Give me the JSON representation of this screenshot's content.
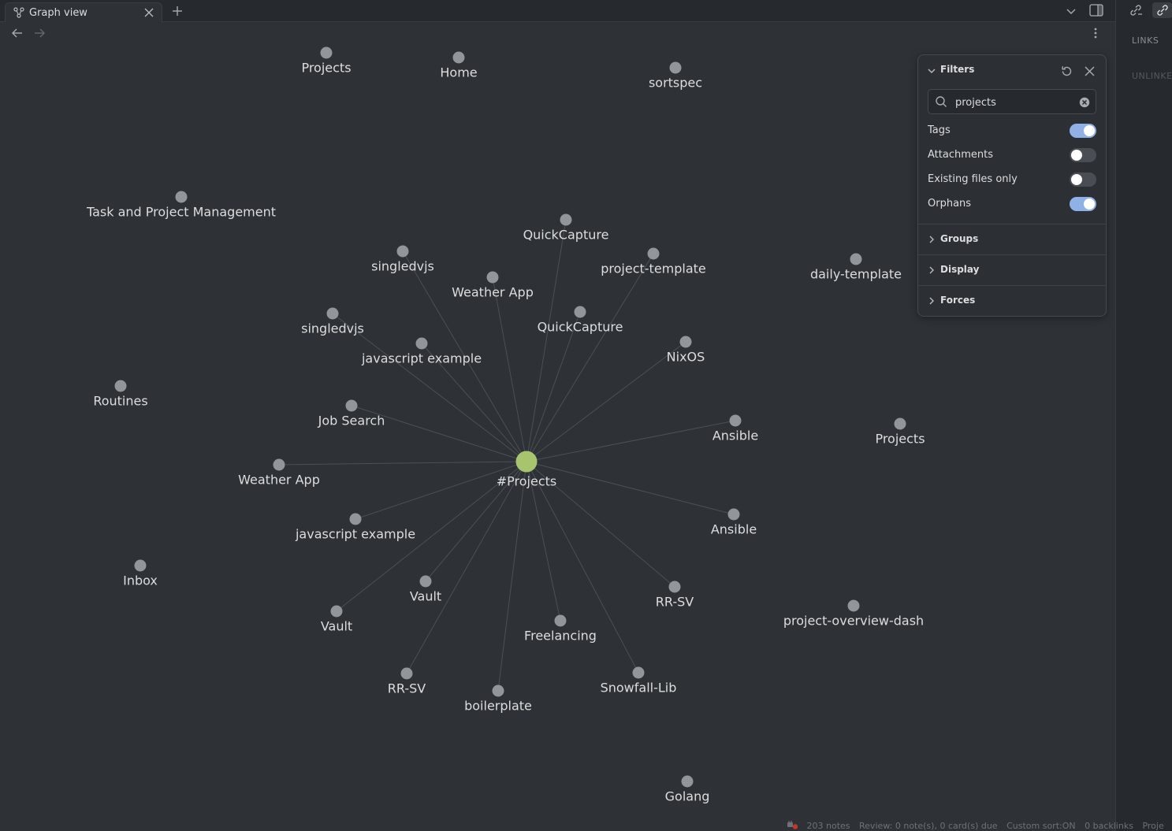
{
  "tab": {
    "title": "Graph view",
    "icon": "graph-icon"
  },
  "toolbar": {
    "back": "arrow-left-icon",
    "forward": "arrow-right-icon",
    "more": "more-vertical-icon"
  },
  "right_panel": {
    "links_label": "LINKS",
    "unlinked_label": "UNLINKE"
  },
  "filters": {
    "title": "Filters",
    "search": {
      "value": "projects"
    },
    "toggles": [
      {
        "label": "Tags",
        "on": true
      },
      {
        "label": "Attachments",
        "on": false
      },
      {
        "label": "Existing files only",
        "on": false
      },
      {
        "label": "Orphans",
        "on": true
      }
    ],
    "sections": [
      "Groups",
      "Display",
      "Forces"
    ]
  },
  "graph": {
    "center": "#Projects",
    "connected": [
      "QuickCapture",
      "project-template",
      "singledvjs",
      "Weather App",
      "singledvjs",
      "QuickCapture",
      "javascript example",
      "NixOS",
      "Job Search",
      "Ansible",
      "Weather App",
      "Ansible",
      "javascript example",
      "Vault",
      "RR-SV",
      "Vault",
      "Freelancing",
      "RR-SV",
      "Snowfall-Lib",
      "boilerplate"
    ],
    "orphans": [
      "Projects",
      "Home",
      "sortspec",
      "Task and Project Management",
      "daily-template",
      "Routines",
      "Projects",
      "Inbox",
      "project-overview-dash",
      "Golang"
    ],
    "colors": {
      "center": "#a7c46f",
      "node": "#929599",
      "edge": "#4c5056"
    }
  },
  "status": {
    "notes": "203 notes",
    "review": "Review: 0 note(s), 0 card(s) due",
    "sort": "Custom sort:ON",
    "backlinks": "0 backlinks",
    "file": "Proje"
  }
}
